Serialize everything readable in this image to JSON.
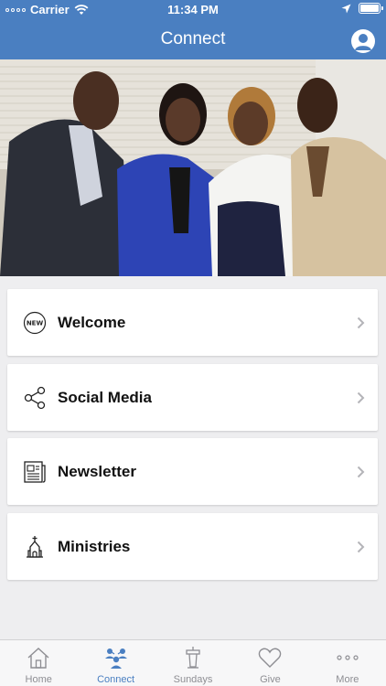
{
  "status_bar": {
    "carrier": "Carrier",
    "time": "11:34 PM"
  },
  "header": {
    "title": "Connect"
  },
  "hero": {
    "description_icon": "group-photo"
  },
  "menu": {
    "items": [
      {
        "label": "Welcome",
        "icon": "new-badge-icon"
      },
      {
        "label": "Social Media",
        "icon": "share-icon"
      },
      {
        "label": "Newsletter",
        "icon": "newspaper-icon"
      },
      {
        "label": "Ministries",
        "icon": "church-icon"
      }
    ]
  },
  "tabbar": {
    "tabs": [
      {
        "label": "Home",
        "icon": "home-icon",
        "active": false
      },
      {
        "label": "Connect",
        "icon": "people-icon",
        "active": true
      },
      {
        "label": "Sundays",
        "icon": "podium-icon",
        "active": false
      },
      {
        "label": "Give",
        "icon": "heart-icon",
        "active": false
      },
      {
        "label": "More",
        "icon": "ellipsis-icon",
        "active": false
      }
    ]
  },
  "colors": {
    "accent": "#4a7fc1",
    "inactive": "#8e8e93",
    "background": "#eeeef0"
  },
  "badge_text": "NEW"
}
